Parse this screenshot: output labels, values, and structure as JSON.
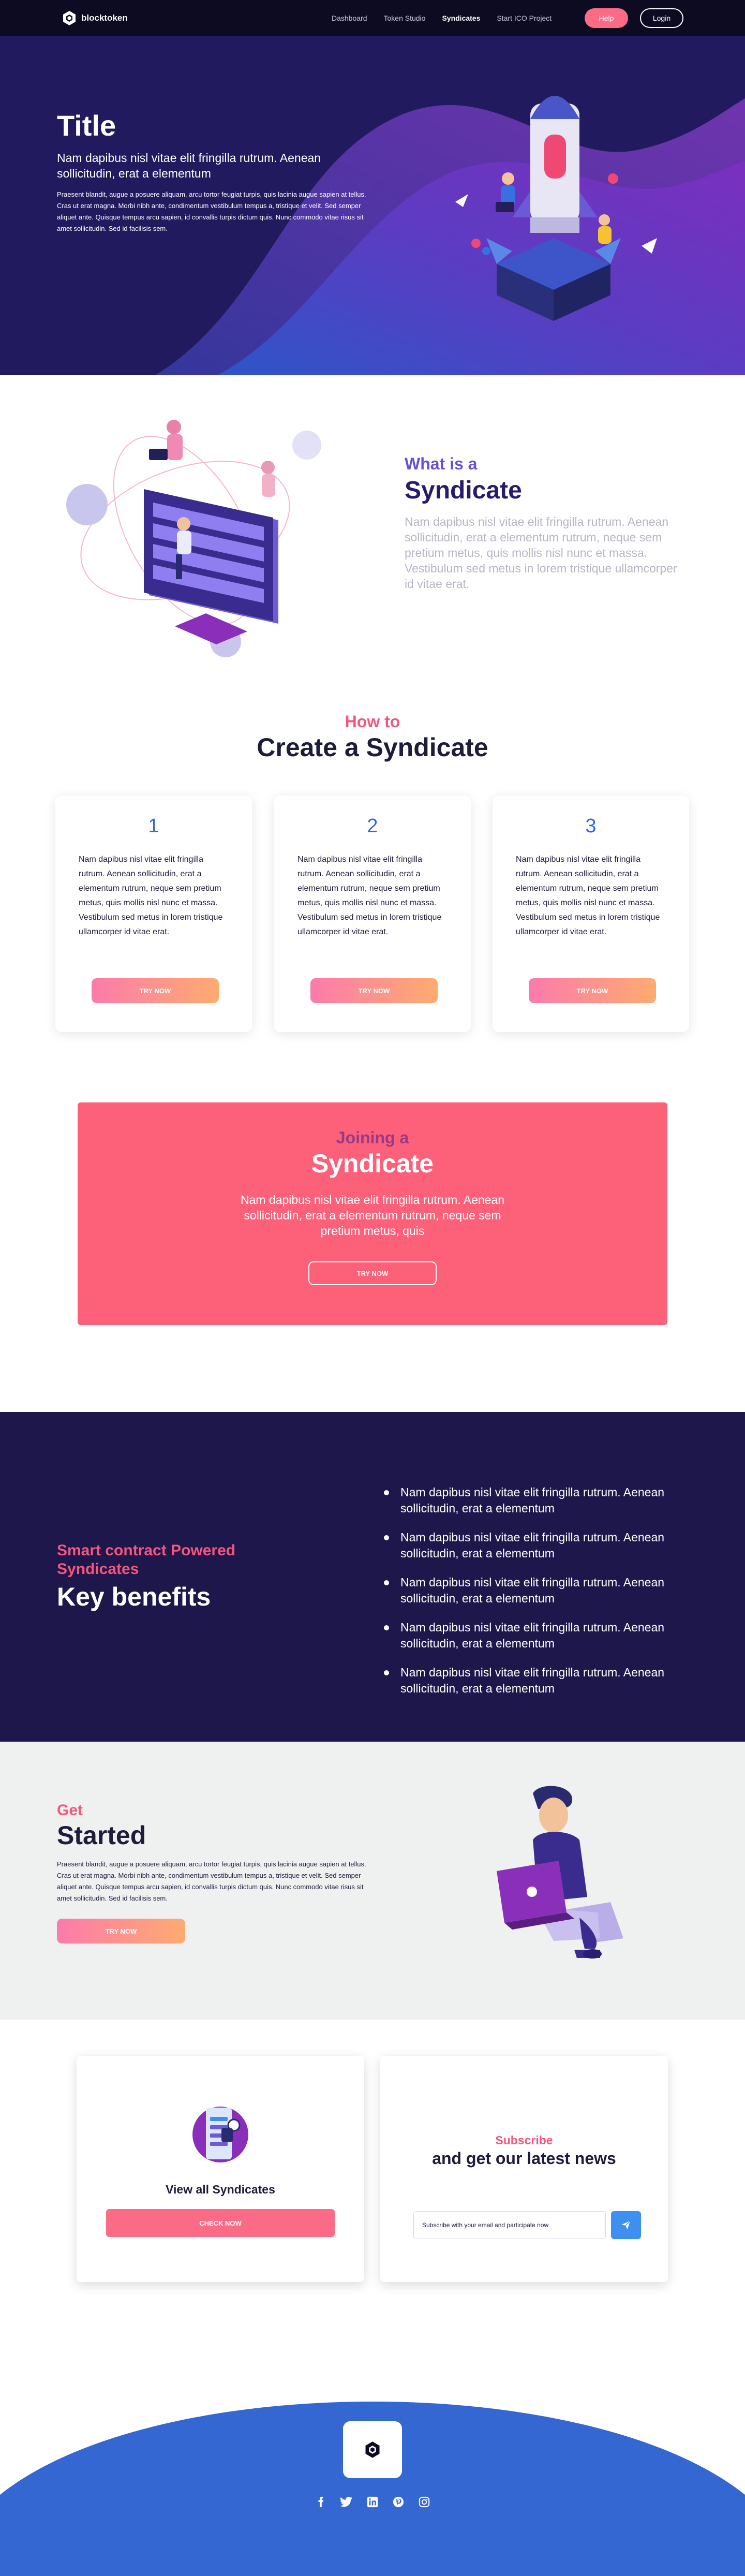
{
  "nav": {
    "brand": "blocktoken",
    "links": [
      {
        "label": "Dashboard",
        "active": false
      },
      {
        "label": "Token Studio",
        "active": false
      },
      {
        "label": "Syndicates",
        "active": true
      },
      {
        "label": "Start ICO Project",
        "active": false
      }
    ],
    "help_label": "Help",
    "login_label": "Login"
  },
  "hero": {
    "title": "Title",
    "subtitle": "Nam dapibus nisl vitae elit fringilla rutrum. Aenean sollicitudin, erat a elementum",
    "body": "Praesent blandit, augue a posuere aliquam, arcu tortor feugiat turpis, quis lacinia augue sapien at tellus. Cras ut erat magna. Morbi nibh ante, condimentum vestibulum tempus a, tristique et velit. Sed semper aliquet ante. Quisque tempus arcu sapien, id convallis turpis dictum quis. Nunc commodo vitae risus sit amet sollicitudin. Sed id facilisis sem."
  },
  "whatis": {
    "kicker": "What is a",
    "title": "Syndicate",
    "body": "Nam dapibus nisl vitae elit fringilla rutrum. Aenean sollicitudin, erat a elementum rutrum, neque sem pretium metus, quis mollis nisl nunc et massa. Vestibulum sed metus in lorem tristique ullamcorper id vitae erat."
  },
  "howto": {
    "kicker": "How to",
    "title": "Create a Syndicate",
    "cards": [
      {
        "number": "1",
        "text": "Nam dapibus nisl vitae elit fringilla rutrum. Aenean sollicitudin, erat a elementum rutrum, neque sem pretium metus, quis mollis nisl nunc et massa. Vestibulum sed metus in lorem tristique ullamcorper id vitae erat.",
        "button": "TRY NOW"
      },
      {
        "number": "2",
        "text": "Nam dapibus nisl vitae elit fringilla rutrum. Aenean sollicitudin, erat a elementum rutrum, neque sem pretium metus, quis mollis nisl nunc et massa. Vestibulum sed metus in lorem tristique ullamcorper id vitae erat.",
        "button": "TRY NOW"
      },
      {
        "number": "3",
        "text": "Nam dapibus nisl vitae elit fringilla rutrum. Aenean sollicitudin, erat a elementum rutrum, neque sem pretium metus, quis mollis nisl nunc et massa. Vestibulum sed metus in lorem tristique ullamcorper id vitae erat.",
        "button": "TRY NOW"
      }
    ]
  },
  "joining": {
    "kicker": "Joining a",
    "title": "Syndicate",
    "body": "Nam dapibus nisl vitae elit fringilla rutrum. Aenean sollicitudin, erat a elementum rutrum, neque sem pretium metus, quis",
    "button": "TRY NOW"
  },
  "benefits": {
    "kicker": "Smart contract Powered Syndicates",
    "title": "Key benefits",
    "items": [
      "Nam dapibus nisl vitae elit fringilla rutrum. Aenean sollicitudin, erat a elementum",
      "Nam dapibus nisl vitae elit fringilla rutrum. Aenean sollicitudin, erat a elementum",
      "Nam dapibus nisl vitae elit fringilla rutrum. Aenean sollicitudin, erat a elementum",
      "Nam dapibus nisl vitae elit fringilla rutrum. Aenean sollicitudin, erat a elementum",
      "Nam dapibus nisl vitae elit fringilla rutrum. Aenean sollicitudin, erat a elementum"
    ]
  },
  "started": {
    "kicker": "Get",
    "title": "Started",
    "body": "Praesent blandit, augue a posuere aliquam, arcu tortor feugiat turpis, quis lacinia augue sapien at tellus. Cras ut erat magna. Morbi nibh ante, condimentum vestibulum tempus a, tristique et velit. Sed semper aliquet ante. Quisque tempus arcu sapien, id convallis turpis dictum quis. Nunc commodo vitae risus sit amet sollicitudin. Sed id facilisis sem.",
    "button": "TRY NOW"
  },
  "view_all": {
    "title": "View all Syndicates",
    "button": "CHECK NOW"
  },
  "subscribe": {
    "kicker": "Subscribe",
    "title": "and get our latest news",
    "placeholder": "Subscribe with your email and participate now",
    "send_icon": "send-icon"
  },
  "footer": {
    "socials": [
      "facebook-icon",
      "twitter-icon",
      "linkedin-icon",
      "pinterest-icon",
      "instagram-icon"
    ]
  },
  "colors": {
    "nav_bg": "#0d0b22",
    "hero_bg": "#241a63",
    "accent_pink": "#fb6b86",
    "number_blue": "#2f6ae0",
    "benefits_bg": "#1e174c",
    "footer_blue": "#3567d2"
  }
}
